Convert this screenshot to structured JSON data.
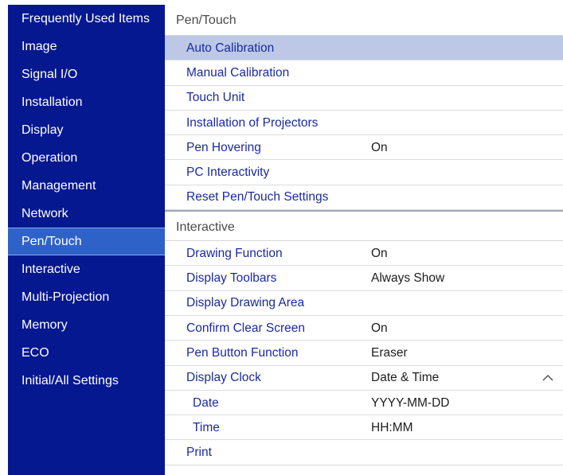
{
  "sidebar": {
    "items": [
      {
        "label": "Frequently Used Items"
      },
      {
        "label": "Image"
      },
      {
        "label": "Signal I/O"
      },
      {
        "label": "Installation"
      },
      {
        "label": "Display"
      },
      {
        "label": "Operation"
      },
      {
        "label": "Management"
      },
      {
        "label": "Network"
      },
      {
        "label": "Pen/Touch"
      },
      {
        "label": "Interactive"
      },
      {
        "label": "Multi-Projection"
      },
      {
        "label": "Memory"
      },
      {
        "label": "ECO"
      },
      {
        "label": "Initial/All Settings"
      }
    ],
    "active": "Pen/Touch"
  },
  "pen_touch": {
    "header": "Pen/Touch",
    "rows": [
      {
        "label": "Auto Calibration",
        "value": ""
      },
      {
        "label": "Manual Calibration",
        "value": ""
      },
      {
        "label": "Touch Unit",
        "value": ""
      },
      {
        "label": "Installation of Projectors",
        "value": ""
      },
      {
        "label": "Pen Hovering",
        "value": "On"
      },
      {
        "label": "PC Interactivity",
        "value": ""
      },
      {
        "label": "Reset Pen/Touch Settings",
        "value": ""
      }
    ]
  },
  "interactive": {
    "header": "Interactive",
    "rows": [
      {
        "label": "Drawing Function",
        "value": "On"
      },
      {
        "label": "Display Toolbars",
        "value": "Always Show"
      },
      {
        "label": "Display Drawing Area",
        "value": ""
      },
      {
        "label": "Confirm Clear Screen",
        "value": "On"
      },
      {
        "label": "Pen Button Function",
        "value": "Eraser"
      },
      {
        "label": "Display Clock",
        "value": "Date & Time"
      },
      {
        "label": "Date",
        "value": "YYYY-MM-DD"
      },
      {
        "label": "Time",
        "value": "HH:MM"
      },
      {
        "label": "Print",
        "value": ""
      }
    ]
  },
  "icons": {
    "expanded": "chevron-up-icon"
  },
  "colors": {
    "sidebar_bg": "#06188f",
    "sidebar_active": "#2e62c9",
    "selected_row": "#bcc8e5",
    "label_text": "#1a2aa0"
  }
}
